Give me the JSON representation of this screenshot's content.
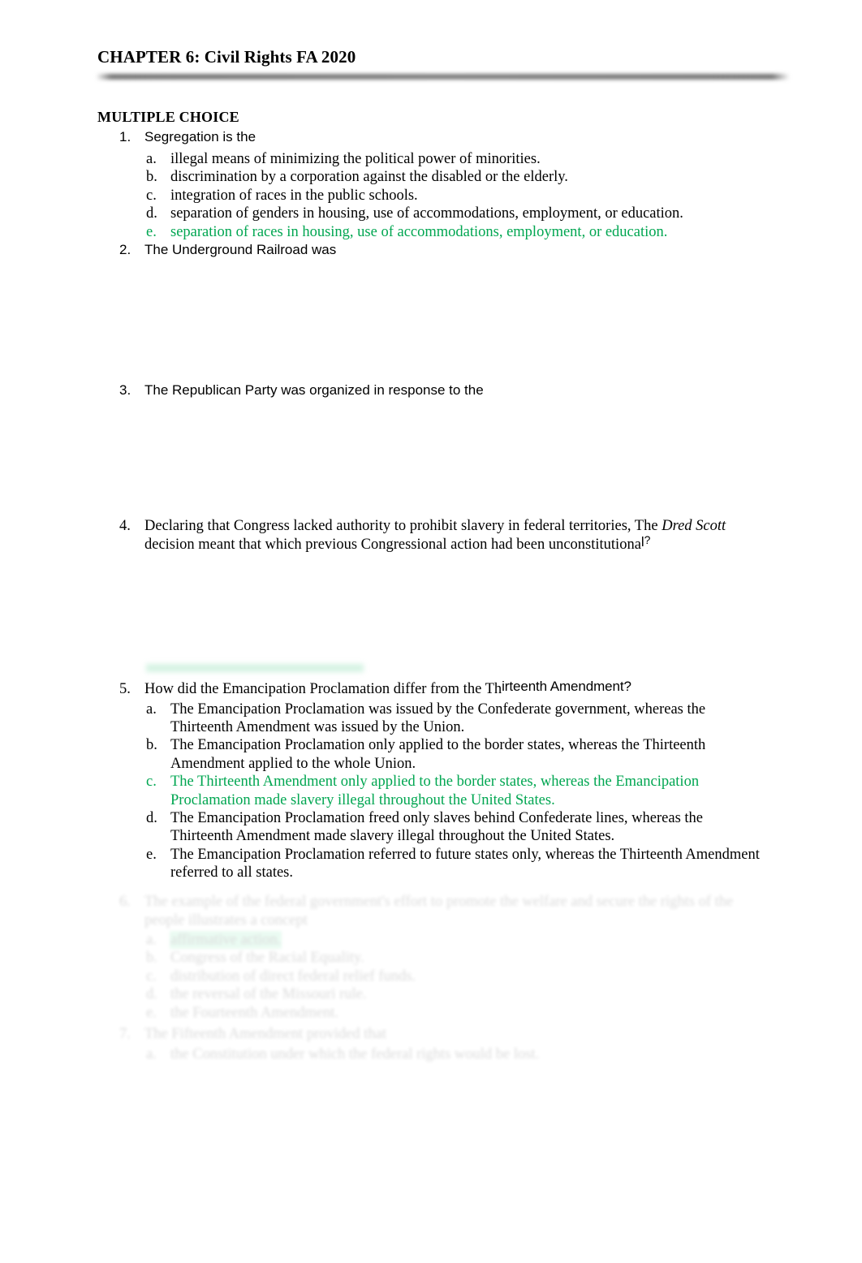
{
  "document": {
    "title": "CHAPTER 6: Civil Rights FA 2020",
    "section_heading": "MULTIPLE CHOICE",
    "answer_color": "#00a651",
    "highlight_color": "#7de6af",
    "rule_color": "#7e7e7e"
  },
  "questions": [
    {
      "number": "1.",
      "stem": "Segregation is the",
      "options": [
        {
          "letter": "a.",
          "text": "illegal means of minimizing the political power of minorities.",
          "highlighted": false
        },
        {
          "letter": "b.",
          "text": "discrimination by a corporation against the disabled or the elderly.",
          "highlighted": false
        },
        {
          "letter": "c.",
          "text": "integration of races in the public schools.",
          "highlighted": false
        },
        {
          "letter": "d.",
          "text": "separation of genders in housing, use of accommodations, employment, or education.",
          "highlighted": false
        },
        {
          "letter": "e.",
          "text": "separation of races in housing, use of accommodations, employment, or education.",
          "highlighted": true
        }
      ]
    },
    {
      "number": "2.",
      "stem": "The Underground Railroad was",
      "options": []
    },
    {
      "number": "3.",
      "stem": "The Republican Party was organized in response to the",
      "options": []
    },
    {
      "number": "4.",
      "stem_part_1": "Declaring that Congress lacked authority to prohibit slavery in federal territories, The ",
      "stem_italic": "Dred Scott",
      "stem_part_2": " decision meant that which previous Congressional action had been unconstitutiona",
      "stem_part_3": "l",
      "stem_part_4": "?",
      "options": []
    },
    {
      "number": "5.",
      "stem_part_1": "How did the Emancipation Proclamation differ from the Th",
      "stem_part_2": "irteenth Amendment?",
      "options": [
        {
          "letter": "a.",
          "text": "The Emancipation Proclamation was issued by the Confederate government, whereas the Thirteenth Amendment was issued by the Union.",
          "highlighted": false
        },
        {
          "letter": "b.",
          "text": "The Emancipation Proclamation only applied to the border states, whereas the Thirteenth Amendment applied to the whole Union.",
          "highlighted": false
        },
        {
          "letter": "c.",
          "text": "The Thirteenth Amendment only applied to the border states, whereas the Emancipation Proclamation made slavery illegal throughout the United States.",
          "highlighted": true
        },
        {
          "letter": "d.",
          "text": "The Emancipation Proclamation freed only slaves behind Confederate lines, whereas the Thirteenth Amendment made slavery illegal throughout the United States.",
          "highlighted": false
        },
        {
          "letter": "e.",
          "text": "The Emancipation Proclamation referred to future states only, whereas the Thirteenth Amendment referred to all states.",
          "highlighted": false
        }
      ]
    }
  ],
  "faded_questions": [
    {
      "number": "6.",
      "stem": "The example of the federal government's effort to promote the welfare and secure the rights of the people illustrates a concept",
      "options": [
        {
          "letter": "a.",
          "text": "affirmative action.",
          "highlighted": true
        },
        {
          "letter": "b.",
          "text": "Congress of the Racial Equality.",
          "highlighted": false
        },
        {
          "letter": "c.",
          "text": "distribution of direct federal relief funds.",
          "highlighted": false
        },
        {
          "letter": "d.",
          "text": "the reversal of the Missouri rule.",
          "highlighted": false
        },
        {
          "letter": "e.",
          "text": "the Fourteenth Amendment.",
          "highlighted": false
        }
      ]
    },
    {
      "number": "7.",
      "stem": "The Fifteenth Amendment provided that",
      "options": [
        {
          "letter": "a.",
          "text": "the Constitution under which the federal rights would be lost.",
          "highlighted": false
        }
      ]
    }
  ]
}
